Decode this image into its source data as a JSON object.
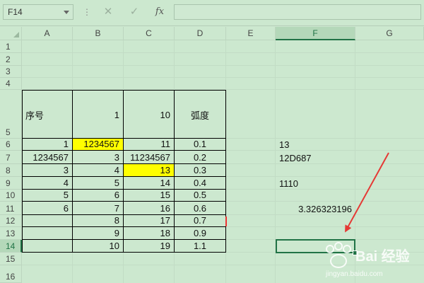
{
  "formula_bar": {
    "name_box": "F14",
    "separator": "⋮",
    "cancel_icon": "✕",
    "enter_icon": "✓",
    "fx_label": "fx",
    "formula": ""
  },
  "columns": [
    "A",
    "B",
    "C",
    "D",
    "E",
    "F",
    "G"
  ],
  "active_column": "F",
  "rows": [
    "1",
    "2",
    "3",
    "4",
    "5",
    "6",
    "7",
    "8",
    "9",
    "10",
    "11",
    "12",
    "13",
    "14",
    "15",
    "16"
  ],
  "active_row": "14",
  "table": {
    "header": [
      "序号",
      "1",
      "10",
      "弧度"
    ],
    "rows": [
      [
        "1",
        "1234567",
        "11",
        "0.1"
      ],
      [
        "1234567",
        "3",
        "11234567",
        "0.2"
      ],
      [
        "3",
        "4",
        "13",
        "0.3"
      ],
      [
        "4",
        "5",
        "14",
        "0.4"
      ],
      [
        "5",
        "6",
        "15",
        "0.5"
      ],
      [
        "6",
        "7",
        "16",
        "0.6"
      ],
      [
        "",
        "8",
        "17",
        "0.7"
      ],
      [
        "",
        "9",
        "18",
        "0.9"
      ],
      [
        "",
        "10",
        "19",
        "1.1"
      ]
    ]
  },
  "column_f": {
    "f6": "13",
    "f7": "12D687",
    "f9": "1110",
    "f11": "3.326323196"
  },
  "highlight_color": "#ffff00",
  "grid_background": "#cce8cf",
  "arrow_color": "#e53935",
  "watermark": {
    "brand": "Bai 经验",
    "url": "jingyan.baidu.com"
  }
}
